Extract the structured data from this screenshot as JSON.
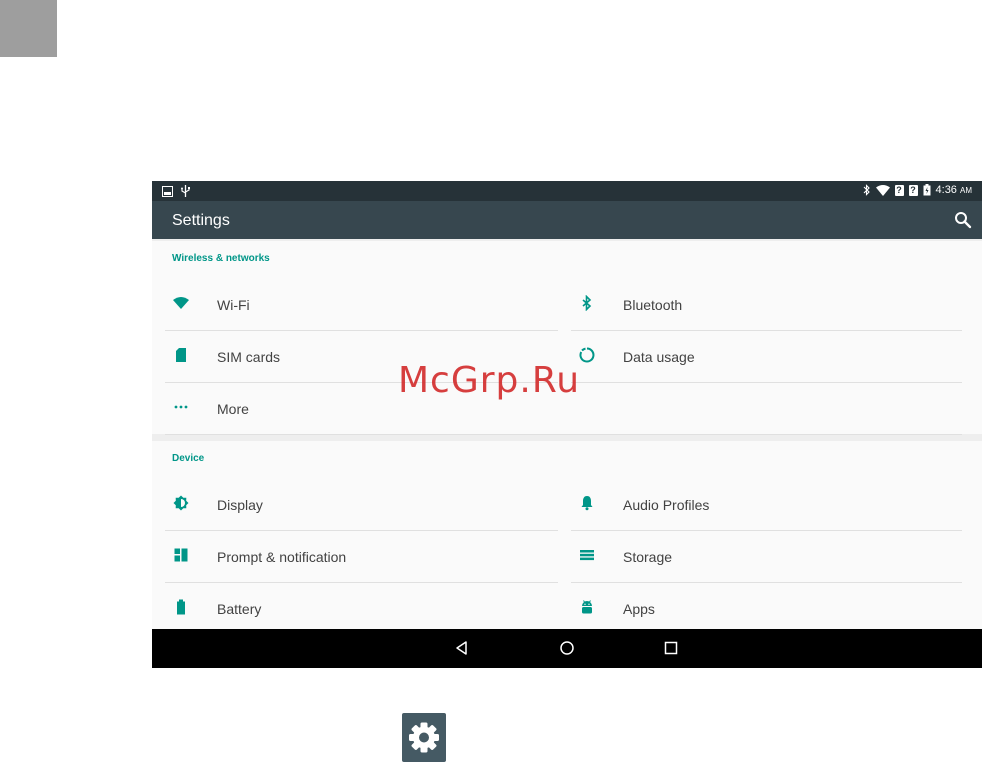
{
  "status_bar": {
    "sim1": "?",
    "sim2": "?",
    "time": "4:36",
    "ampm": "AM"
  },
  "action_bar": {
    "title": "Settings"
  },
  "sections": {
    "wireless": {
      "header": "Wireless & networks",
      "items": [
        {
          "label": "Wi-Fi",
          "icon": "wifi-icon"
        },
        {
          "label": "Bluetooth",
          "icon": "bluetooth-icon"
        },
        {
          "label": "SIM cards",
          "icon": "sim-card-icon"
        },
        {
          "label": "Data usage",
          "icon": "data-usage-icon"
        },
        {
          "label": "More",
          "icon": "more-icon"
        }
      ]
    },
    "device": {
      "header": "Device",
      "items": [
        {
          "label": "Display",
          "icon": "display-icon"
        },
        {
          "label": "Audio Profiles",
          "icon": "bell-icon"
        },
        {
          "label": "Prompt & notification",
          "icon": "notification-icon"
        },
        {
          "label": "Storage",
          "icon": "storage-icon"
        },
        {
          "label": "Battery",
          "icon": "battery-icon"
        },
        {
          "label": "Apps",
          "icon": "android-icon"
        }
      ]
    }
  },
  "watermark": "McGrp.Ru",
  "colors": {
    "accent": "#009688",
    "status_bar": "#263238",
    "action_bar": "#37474f",
    "watermark": "#d32f2f"
  }
}
